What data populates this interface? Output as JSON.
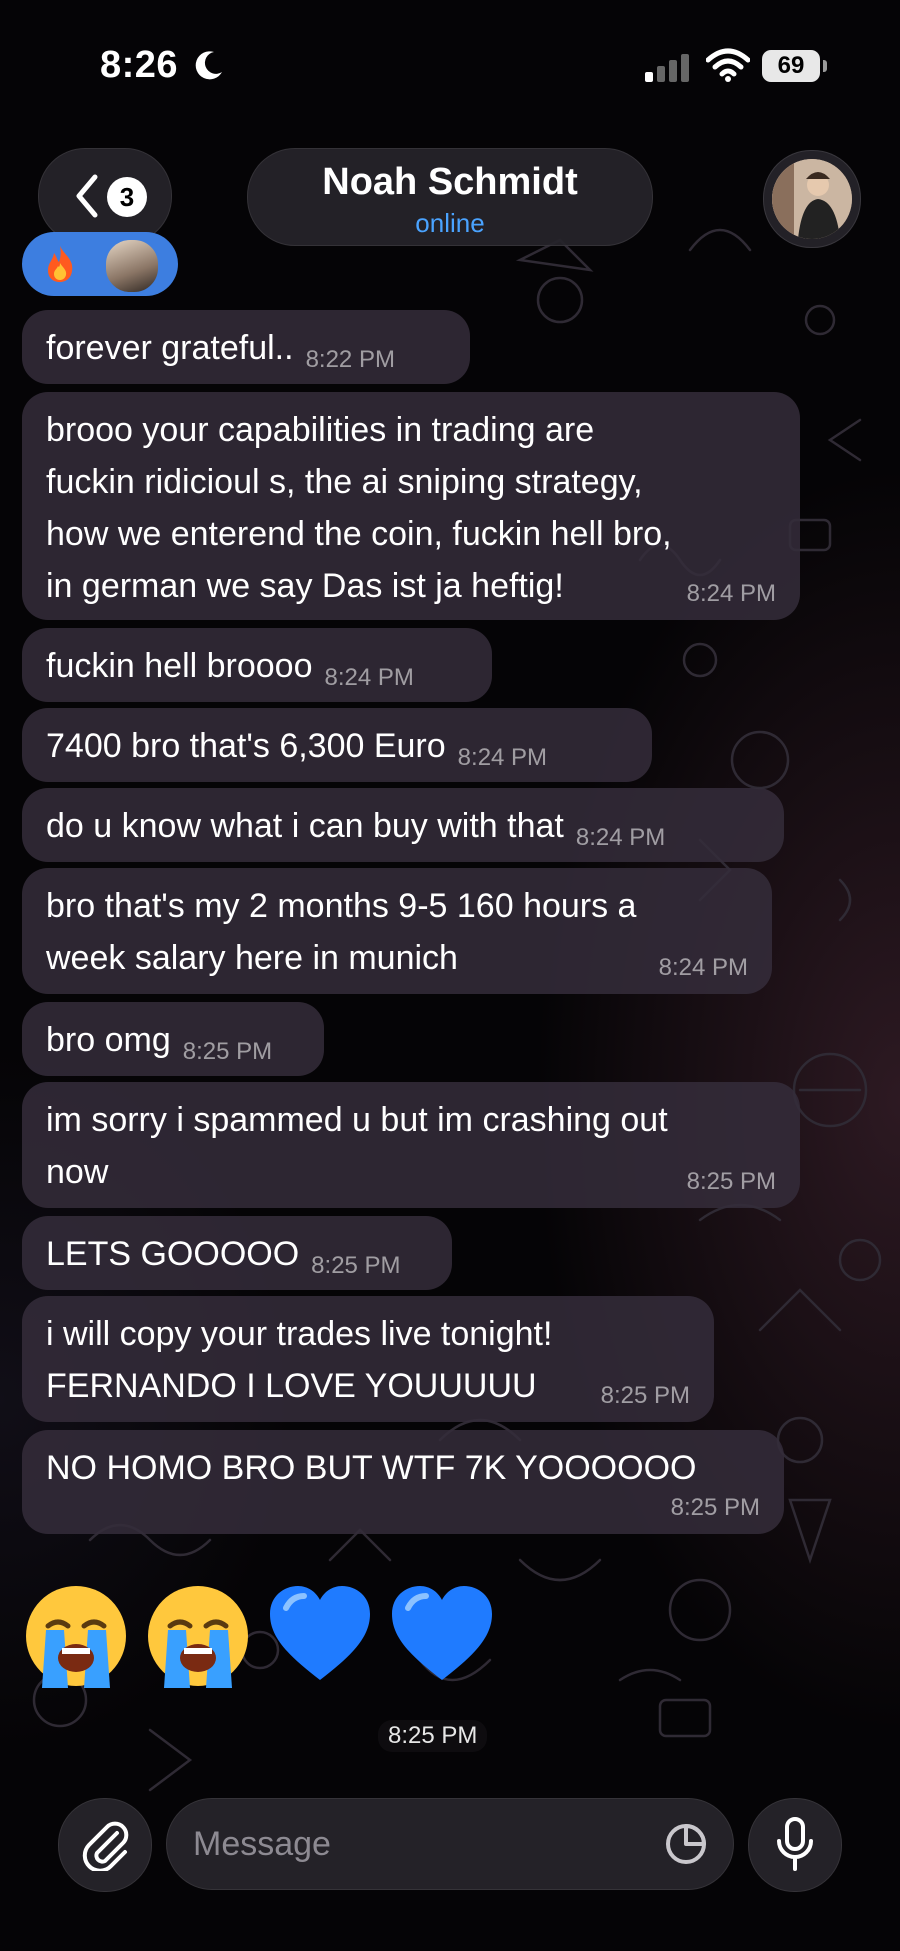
{
  "status_bar": {
    "time": "8:26",
    "battery": "69",
    "icons": [
      "moon-icon",
      "signal-icon",
      "wifi-icon",
      "battery-icon"
    ]
  },
  "header": {
    "back_badge": "3",
    "contact_name": "Noah Schmidt",
    "contact_status": "online",
    "icons": [
      "chevron-left-icon",
      "avatar"
    ]
  },
  "reaction": {
    "emoji": "fire",
    "icons": [
      "fire-icon"
    ]
  },
  "messages": [
    {
      "text": "forever grateful..",
      "time": "8:22 PM"
    },
    {
      "text": "brooo your capabilities in trading are\nfuckin ridicioul s, the ai sniping strategy,\nhow we enterend the coin, fuckin hell bro,\nin german we say Das ist ja heftig!",
      "time": "8:24 PM"
    },
    {
      "text": "fuckin hell broooo",
      "time": "8:24 PM"
    },
    {
      "text": "7400 bro that's 6,300 Euro",
      "time": "8:24 PM"
    },
    {
      "text": "do u know what i can buy with that",
      "time": "8:24 PM"
    },
    {
      "text": "bro that's my 2 months 9-5 160 hours a\nweek salary here in munich",
      "time": "8:24 PM"
    },
    {
      "text": "bro omg",
      "time": "8:25 PM"
    },
    {
      "text": "im sorry i spammed u but im crashing out\nnow",
      "time": "8:25 PM"
    },
    {
      "text": "LETS GOOOOO",
      "time": "8:25 PM"
    },
    {
      "text": "i will copy your trades live tonight!\nFERNANDO I LOVE YOUUUUU",
      "time": "8:25 PM"
    },
    {
      "text": "NO HOMO BRO BUT WTF 7K YOOOOOO",
      "time": "8:25 PM"
    }
  ],
  "emoji_message": {
    "emojis": [
      "loudly-crying-face",
      "loudly-crying-face",
      "blue-heart",
      "blue-heart"
    ],
    "time": "8:25 PM"
  },
  "input_bar": {
    "placeholder": "Message",
    "icons": [
      "paperclip-icon",
      "sticker-icon",
      "mic-icon"
    ]
  }
}
